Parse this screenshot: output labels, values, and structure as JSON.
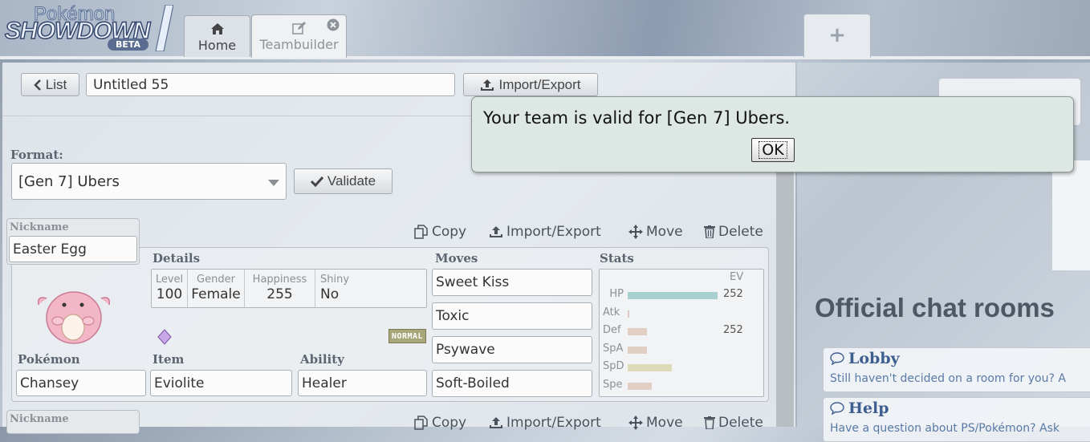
{
  "logo": {
    "top": "Pokémon",
    "main": "SHOWDOWN",
    "beta": "BETA"
  },
  "tabs": [
    {
      "label": "Home",
      "icon": "home-icon"
    },
    {
      "label": "Teambuilder",
      "icon": "edit-icon"
    }
  ],
  "new_tab": "+",
  "toolbar": {
    "list_label": "List",
    "team_name": "Untitled 55",
    "import_export_label": "Import/Export"
  },
  "format": {
    "label": "Format:",
    "value": "[Gen 7] Ubers",
    "validate_label": "Validate"
  },
  "set1": {
    "nickname_label": "Nickname",
    "nickname": "Easter Egg",
    "actions": {
      "copy": "Copy",
      "import_export": "Import/Export",
      "move": "Move",
      "delete": "Delete"
    },
    "details_label": "Details",
    "details": [
      {
        "label": "Level",
        "value": "100"
      },
      {
        "label": "Gender",
        "value": "Female"
      },
      {
        "label": "Happiness",
        "value": "255"
      },
      {
        "label": "Shiny",
        "value": "No"
      }
    ],
    "type_badge": "NORMAL",
    "pokemon_label": "Pokémon",
    "pokemon": "Chansey",
    "item_label": "Item",
    "item": "Eviolite",
    "ability_label": "Ability",
    "ability": "Healer",
    "moves_label": "Moves",
    "moves": [
      "Sweet Kiss",
      "Toxic",
      "Psywave",
      "Soft-Boiled"
    ],
    "stats_label": "Stats",
    "ev_label": "EV",
    "stats": [
      {
        "name": "HP",
        "ev": "252",
        "fill": 1.0,
        "color": "#a9d0d0"
      },
      {
        "name": "Atk",
        "ev": "",
        "fill": 0.02,
        "color": "#d8c9c2"
      },
      {
        "name": "Def",
        "ev": "252",
        "fill": 0.21,
        "color": "#e2cfc4"
      },
      {
        "name": "SpA",
        "ev": "",
        "fill": 0.21,
        "color": "#e2cfc4"
      },
      {
        "name": "SpD",
        "ev": "",
        "fill": 0.49,
        "color": "#dedcb8"
      },
      {
        "name": "Spe",
        "ev": "",
        "fill": 0.27,
        "color": "#e2cfc4"
      }
    ]
  },
  "set2": {
    "nickname_label": "Nickname",
    "actions": {
      "copy": "Copy",
      "import_export": "Import/Export",
      "move": "Move",
      "delete": "Delete"
    }
  },
  "rooms": {
    "title": "Official chat rooms",
    "items": [
      {
        "name": "Lobby",
        "desc": "Still haven't decided on a room for you? A"
      },
      {
        "name": "Help",
        "desc": "Have a question about PS/Pokémon? Ask"
      }
    ]
  },
  "popup": {
    "message": "Your team is valid for [Gen 7] Ubers.",
    "ok_label": "OK"
  }
}
